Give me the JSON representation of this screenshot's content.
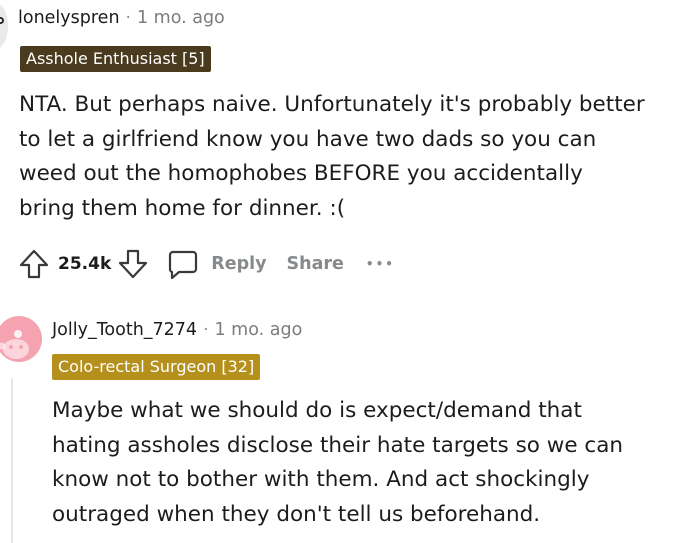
{
  "comments": [
    {
      "username": "lonelyspren",
      "separator": "·",
      "time": "1 mo. ago",
      "flair": {
        "text": "Asshole Enthusiast [5]",
        "color": "#4a3a1e"
      },
      "body": [
        "NTA. But perhaps naive. Unfortunately it's probably better",
        "to let a girlfriend know you have two dads so you can",
        "weed out the homophobes BEFORE you accidentally",
        "bring them home for dinner. :("
      ],
      "avatar_icon": "snoo-avatar-icon"
    },
    {
      "username": "Jolly_Tooth_7274",
      "separator": "·",
      "time": "1 mo. ago",
      "flair": {
        "text": "Colo-rectal Surgeon [32]",
        "color": "#b5901c"
      },
      "body": [
        "Maybe what we should do is expect/demand that",
        "hating assholes disclose their hate targets so we can",
        "know not to bother with them. And act shockingly",
        "outraged when they don't tell us beforehand."
      ],
      "avatar_icon": "snoo-avatar-icon",
      "avatar_color": "#f5a3b0"
    }
  ],
  "actions": {
    "upvote_icon": "upvote-arrow-icon",
    "vote_count": "25.4k",
    "downvote_icon": "downvote-arrow-icon",
    "reply_icon": "comment-bubble-icon",
    "reply_label": "Reply",
    "share_label": "Share",
    "more_icon": "more-options-icon",
    "more_glyph": "•••",
    "label_color": "#878a8c"
  }
}
